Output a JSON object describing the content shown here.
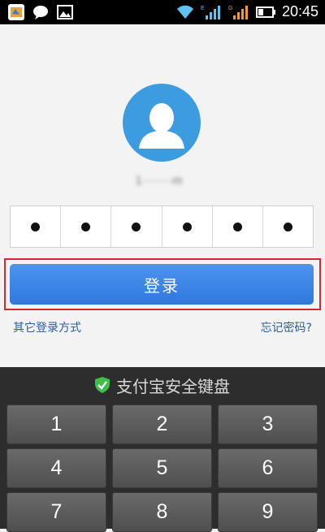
{
  "status_bar": {
    "time": "20:45",
    "icons": [
      "app-notification-icon",
      "chat-bubble-icon",
      "image-icon",
      "wifi-icon",
      "signal-e-icon",
      "signal-g-icon",
      "battery-icon"
    ],
    "sim1_label": "E",
    "sim2_label": "G"
  },
  "login": {
    "username_masked": "1∙∙∙∙∙∙∙m",
    "password_length": 6,
    "password_dot": "●",
    "login_button": "登录",
    "other_login": "其它登录方式",
    "forgot_password": "忘记密码?"
  },
  "keyboard": {
    "title": "支付宝安全键盘",
    "keys": [
      "1",
      "2",
      "3",
      "4",
      "5",
      "6",
      "7",
      "8",
      "9"
    ]
  },
  "colors": {
    "accent": "#3580e4",
    "highlight_outline": "#d8262a",
    "avatar_bg": "#3d9be0",
    "shield_green": "#3fbf4a"
  }
}
